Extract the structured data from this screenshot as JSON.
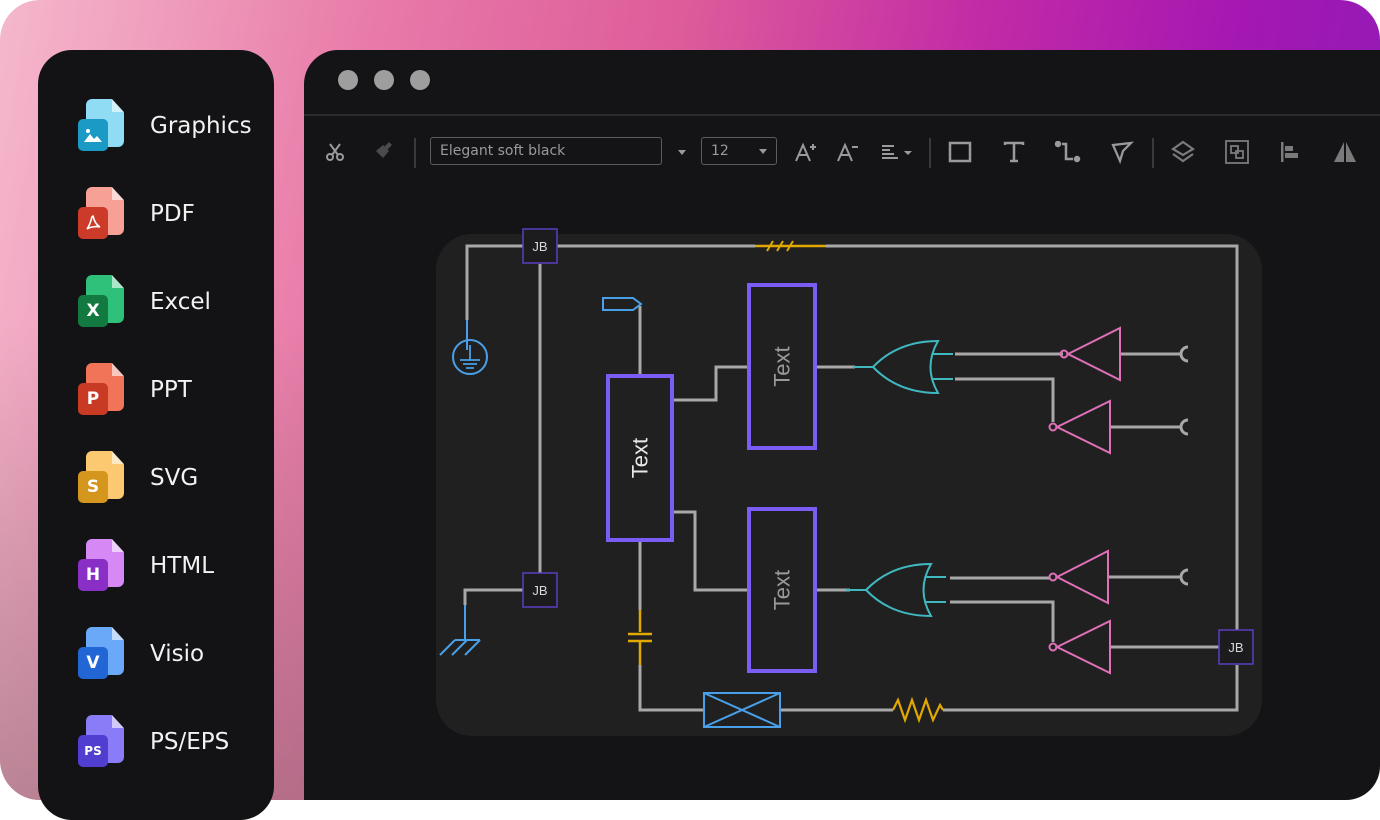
{
  "sidebar": {
    "items": [
      {
        "label": "Graphics",
        "icon": "graphics-file-icon",
        "badge": "",
        "color_page": "#8fdcf4",
        "color_badge": "#1a9ac4"
      },
      {
        "label": "PDF",
        "icon": "pdf-file-icon",
        "badge": "",
        "color_page": "#f6a096",
        "color_badge": "#cc3a2a"
      },
      {
        "label": "Excel",
        "icon": "excel-file-icon",
        "badge": "X",
        "color_page": "#2fc07a",
        "color_badge": "#127a40"
      },
      {
        "label": "PPT",
        "icon": "ppt-file-icon",
        "badge": "P",
        "color_page": "#f27458",
        "color_badge": "#c83a24"
      },
      {
        "label": "SVG",
        "icon": "svg-file-icon",
        "badge": "S",
        "color_page": "#fcc870",
        "color_badge": "#d4961c"
      },
      {
        "label": "HTML",
        "icon": "html-file-icon",
        "badge": "H",
        "color_page": "#d688f4",
        "color_badge": "#8a2fc6"
      },
      {
        "label": "Visio",
        "icon": "visio-file-icon",
        "badge": "V",
        "color_page": "#6aa8f8",
        "color_badge": "#2266d6"
      },
      {
        "label": "PS/EPS",
        "icon": "ps-eps-file-icon",
        "badge": "PS",
        "color_page": "#8a7cf6",
        "color_badge": "#4f3ed0"
      }
    ]
  },
  "toolbar": {
    "font_name": "Elegant soft black",
    "font_size": "12",
    "tools": [
      "cut",
      "format-painter",
      "font-increase",
      "font-decrease",
      "text-align",
      "rectangle",
      "text",
      "connector",
      "select-pointer",
      "layers",
      "group",
      "align-left",
      "flip"
    ]
  },
  "diagram": {
    "junction_label": "JB",
    "block_label": "Text",
    "colors": {
      "wire": "#a8a8a8",
      "block": "#7b5cf5",
      "junction_border": "#5a3fc0",
      "or_gate": "#3fb8c0",
      "not_gate": "#e070b8",
      "ground": "#4aa0e8",
      "component_yellow": "#e0a800",
      "switch": "#4aa0e8"
    }
  }
}
